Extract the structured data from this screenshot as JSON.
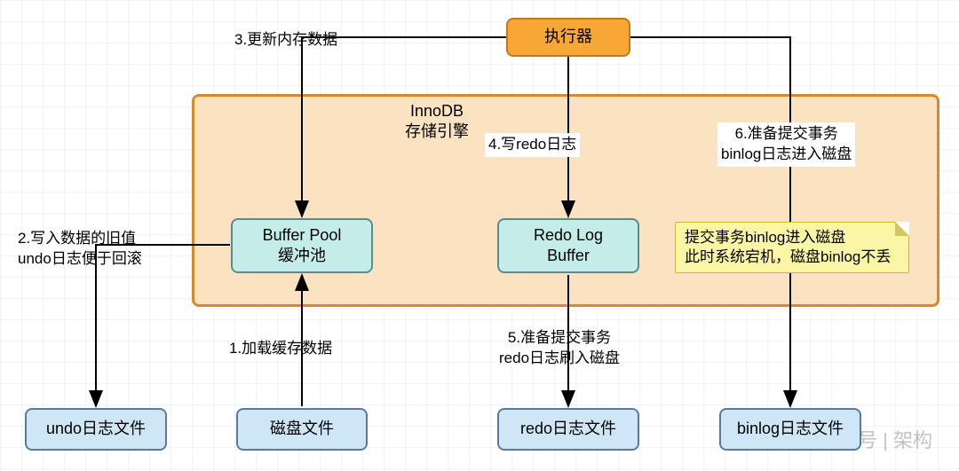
{
  "executor": {
    "label": "执行器"
  },
  "innodb": {
    "title_line1": "InnoDB",
    "title_line2": "存储引擎"
  },
  "buffer_pool": {
    "line1": "Buffer Pool",
    "line2": "缓冲池"
  },
  "redo_log_buffer": {
    "line1": "Redo Log",
    "line2": "Buffer"
  },
  "note": {
    "line1": "提交事务binlog进入磁盘",
    "line2": "此时系统宕机，磁盘binlog不丢"
  },
  "undo_file": {
    "label": "undo日志文件"
  },
  "disk_file": {
    "label": "磁盘文件"
  },
  "redo_file": {
    "label": "redo日志文件"
  },
  "binlog_file": {
    "label": "binlog日志文件"
  },
  "labels": {
    "step1": "1.加载缓存数据",
    "step2_line1": "2.写入数据的旧值",
    "step2_line2": "undo日志便于回滚",
    "step3": "3.更新内存数据",
    "step4": "4.写redo日志",
    "step5_line1": "5.准备提交事务",
    "step5_line2": "redo日志刷入磁盘",
    "step6_line1": "6.准备提交事务",
    "step6_line2": "binlog日志进入磁盘"
  },
  "watermark": {
    "text": "公众号 | 架构"
  }
}
